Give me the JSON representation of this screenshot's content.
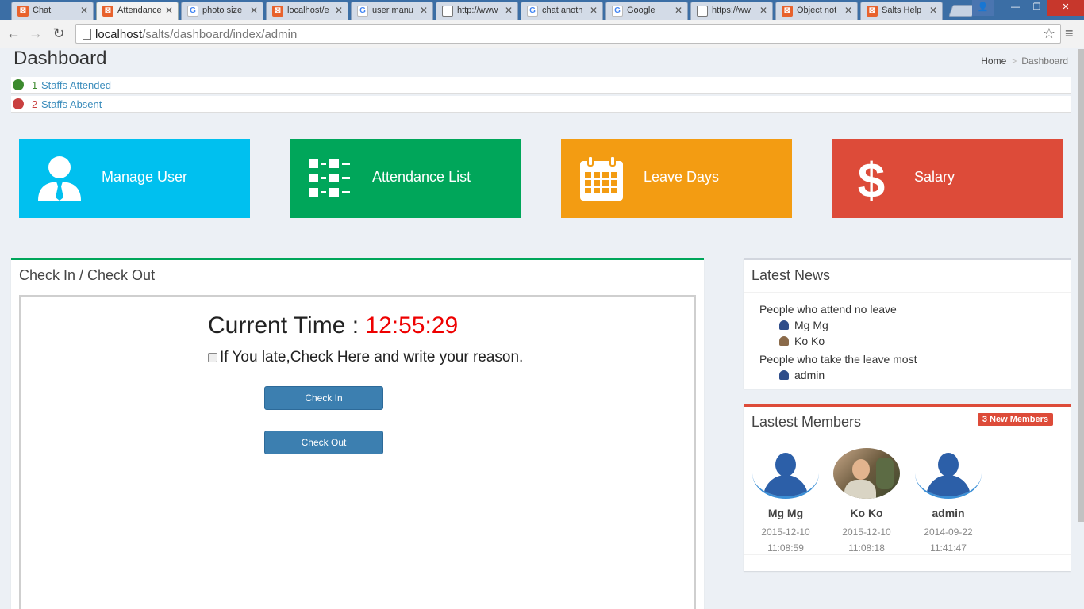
{
  "browser": {
    "tabs": [
      {
        "label": "Chat",
        "icon": "xampp-icon",
        "active": false
      },
      {
        "label": "Attendance",
        "icon": "xampp-icon",
        "active": true
      },
      {
        "label": "photo size",
        "icon": "google-icon",
        "active": false
      },
      {
        "label": "localhost/e",
        "icon": "xampp-icon",
        "active": false
      },
      {
        "label": "user manu",
        "icon": "google-icon",
        "active": false
      },
      {
        "label": "http://www",
        "icon": "page-icon",
        "active": false
      },
      {
        "label": "chat anoth",
        "icon": "google-icon",
        "active": false
      },
      {
        "label": "Google",
        "icon": "google-icon",
        "active": false
      },
      {
        "label": "https://ww",
        "icon": "page-icon",
        "active": false
      },
      {
        "label": "Object not",
        "icon": "xampp-icon",
        "active": false
      },
      {
        "label": "Salts Help",
        "icon": "xampp-icon",
        "active": false
      }
    ],
    "url_host": "localhost",
    "url_path": "/salts/dashboard/index/admin"
  },
  "page": {
    "title": "Dashboard",
    "breadcrumb": {
      "home": "Home",
      "separator": ">",
      "current": "Dashboard"
    }
  },
  "stats": {
    "attended": {
      "count": "1",
      "label": "Staffs Attended",
      "color": "#3c8a2e"
    },
    "absent": {
      "count": "2",
      "label": "Staffs Absent",
      "color": "#c94040"
    }
  },
  "tiles": [
    {
      "label": "Manage User",
      "icon": "user-icon",
      "color": "#00c0ef"
    },
    {
      "label": "Attendance List",
      "icon": "list-icon",
      "color": "#00a65a"
    },
    {
      "label": "Leave Days",
      "icon": "calendar-icon",
      "color": "#f39c12"
    },
    {
      "label": "Salary",
      "icon": "dollar-icon",
      "color": "#dd4b39"
    }
  ],
  "checkin": {
    "title": "Check In / Check Out",
    "time_label": "Current Time : ",
    "time_value": "12:55:29",
    "late_label": "If You late,Check Here and write your reason.",
    "check_in_label": "Check In",
    "check_out_label": "Check Out",
    "accent": "#00a65a"
  },
  "news": {
    "title": "Latest News",
    "attend_heading": "People who attend no leave",
    "attend_people": [
      "Mg Mg",
      "Ko Ko"
    ],
    "leave_heading": "People who take the leave most",
    "leave_people": [
      "admin"
    ]
  },
  "members": {
    "title": "Lastest Members",
    "badge": "3 New Members",
    "accent": "#dd4b39",
    "list": [
      {
        "name": "Mg Mg",
        "date": "2015-12-10",
        "time": "11:08:59",
        "avatar": "silhouette"
      },
      {
        "name": "Ko Ko",
        "date": "2015-12-10",
        "time": "11:08:18",
        "avatar": "photo"
      },
      {
        "name": "admin",
        "date": "2014-09-22",
        "time": "11:41:47",
        "avatar": "silhouette"
      }
    ]
  }
}
